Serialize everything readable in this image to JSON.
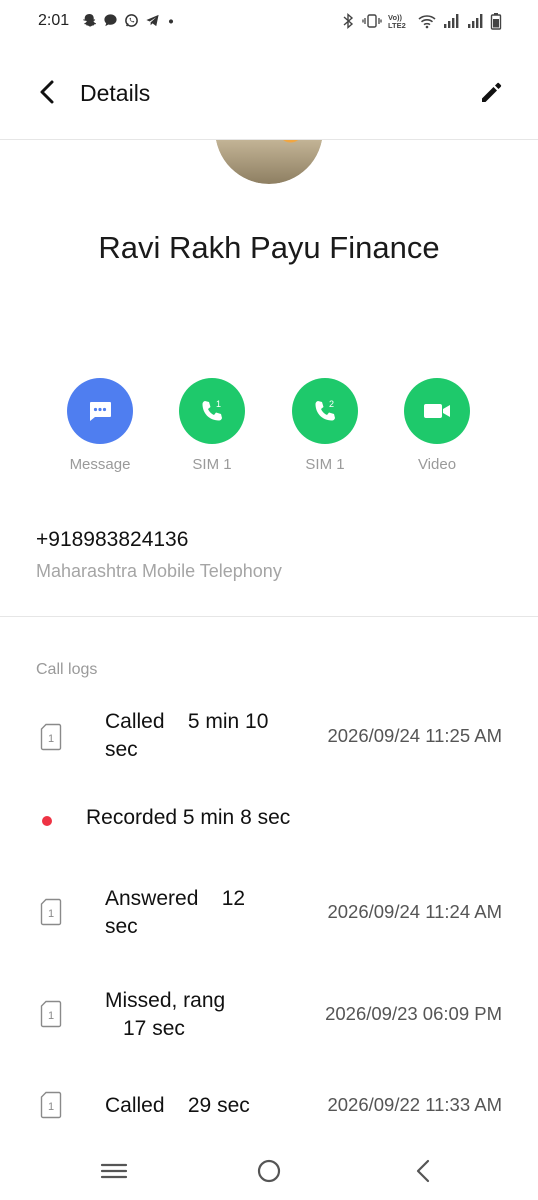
{
  "status_bar": {
    "time": "2:01",
    "left_icons": [
      "snapchat-icon",
      "chat-icon",
      "whatsapp-icon",
      "telegram-icon",
      "dot-icon"
    ],
    "right_icons": [
      "bluetooth-icon",
      "vibrate-icon",
      "volte-icon",
      "wifi-icon",
      "signal-1-icon",
      "signal-2-icon",
      "battery-icon"
    ],
    "volte_label": "Vo)) LTE2"
  },
  "header": {
    "title": "Details",
    "back_icon": "back-chevron-icon",
    "edit_icon": "pencil-icon"
  },
  "contact": {
    "name": "Ravi Rakh Payu Finance",
    "phone": "+918983824136",
    "carrier": "Maharashtra Mobile Telephony"
  },
  "actions": [
    {
      "label": "Message",
      "icon": "message-icon",
      "color": "#4f7ef0"
    },
    {
      "label": "SIM 1",
      "icon": "call-sim1-icon",
      "sim_badge": "1",
      "color": "#1ec96b"
    },
    {
      "label": "SIM 1",
      "icon": "call-sim2-icon",
      "sim_badge": "2",
      "color": "#1ec96b"
    },
    {
      "label": "Video",
      "icon": "video-icon",
      "color": "#1ec96b"
    }
  ],
  "call_logs": {
    "heading": "Call logs",
    "entries": [
      {
        "status_line1": "Called    5 min 10",
        "status_line2": "sec",
        "time": "2026/09/24 11:25 AM",
        "sim": "1"
      },
      {
        "recorded": "Recorded 5 min 8 sec"
      },
      {
        "status_line1": "Answered    12",
        "status_line2": "sec",
        "time": "2026/09/24 11:24 AM",
        "sim": "1"
      },
      {
        "status_line1": "Missed, rang",
        "status_line2": "17 sec",
        "time": "2026/09/23 06:09 PM",
        "sim": "1"
      },
      {
        "status_line1": "Called    29 sec",
        "status_line2": "",
        "time": "2026/09/22 11:33 AM",
        "sim": "1"
      }
    ]
  },
  "colors": {
    "record_dot": "#ee3344",
    "secondary_text": "#9a9a9a"
  },
  "nav_bar": [
    "menu-icon",
    "home-icon",
    "back-icon"
  ]
}
